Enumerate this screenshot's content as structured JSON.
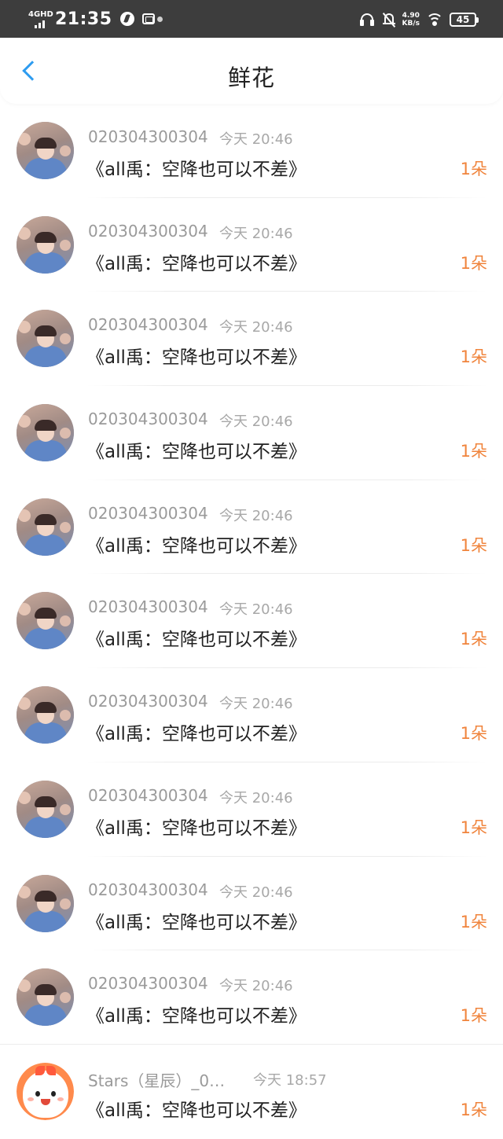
{
  "status_bar": {
    "network": "4GHD",
    "time": "21:35",
    "speed_value": "4.90",
    "speed_unit": "KB/s",
    "battery": "45"
  },
  "nav": {
    "back_icon": "chevron-left-icon",
    "title": "鲜花"
  },
  "colors": {
    "accent_blue": "#2e9cf0",
    "count_orange": "#f0843c",
    "status_bar_bg": "#3d3d3d"
  },
  "gifts": [
    {
      "user": "020304300304",
      "time": "今天 20:46",
      "title": "《all禹：空降也可以不差》",
      "count": "1朵",
      "avatar": "photo"
    },
    {
      "user": "020304300304",
      "time": "今天 20:46",
      "title": "《all禹：空降也可以不差》",
      "count": "1朵",
      "avatar": "photo"
    },
    {
      "user": "020304300304",
      "time": "今天 20:46",
      "title": "《all禹：空降也可以不差》",
      "count": "1朵",
      "avatar": "photo"
    },
    {
      "user": "020304300304",
      "time": "今天 20:46",
      "title": "《all禹：空降也可以不差》",
      "count": "1朵",
      "avatar": "photo"
    },
    {
      "user": "020304300304",
      "time": "今天 20:46",
      "title": "《all禹：空降也可以不差》",
      "count": "1朵",
      "avatar": "photo"
    },
    {
      "user": "020304300304",
      "time": "今天 20:46",
      "title": "《all禹：空降也可以不差》",
      "count": "1朵",
      "avatar": "photo"
    },
    {
      "user": "020304300304",
      "time": "今天 20:46",
      "title": "《all禹：空降也可以不差》",
      "count": "1朵",
      "avatar": "photo"
    },
    {
      "user": "020304300304",
      "time": "今天 20:46",
      "title": "《all禹：空降也可以不差》",
      "count": "1朵",
      "avatar": "photo"
    },
    {
      "user": "020304300304",
      "time": "今天 20:46",
      "title": "《all禹：空降也可以不差》",
      "count": "1朵",
      "avatar": "photo"
    },
    {
      "user": "020304300304",
      "time": "今天 20:46",
      "title": "《all禹：空降也可以不差》",
      "count": "1朵",
      "avatar": "photo"
    },
    {
      "user": "Stars（星辰）_0…",
      "time": "今天 18:57",
      "title": "《all禹：空降也可以不差》",
      "count": "1朵",
      "avatar": "cartoon"
    }
  ]
}
